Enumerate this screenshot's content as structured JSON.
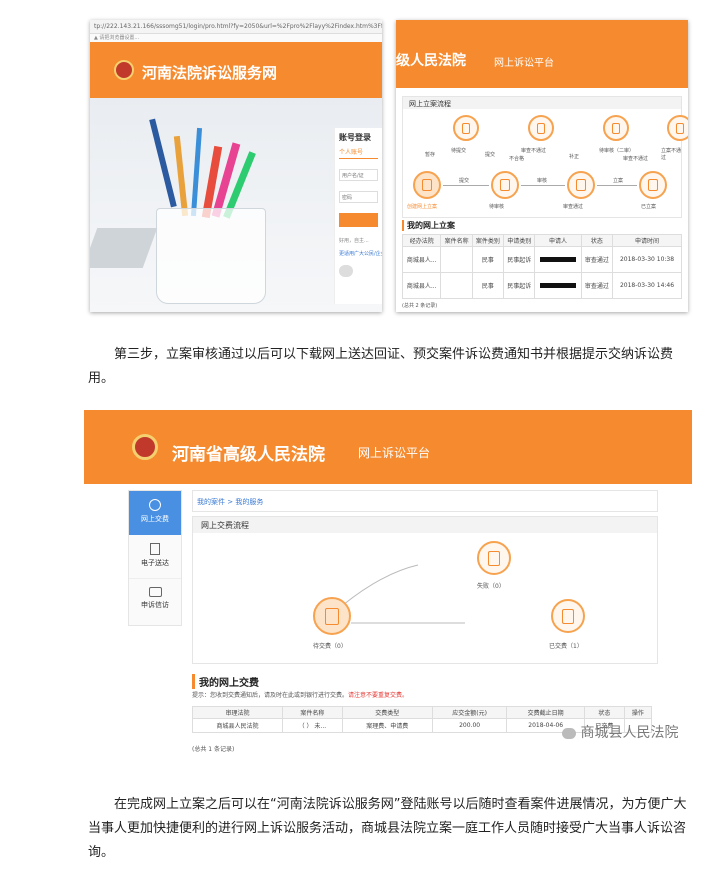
{
  "shot1": {
    "url": "tp://222.143.21.166/sssomg51/login/pro.html?fy=2050&url=%2Fpro%2Flayy%2Findex.htm%3Ffy%3D...",
    "top_note": "▲ 请把浏览器设置...",
    "title": "河南法院诉讼服务网",
    "login_title": "账号登录",
    "login_tab": "个人账号",
    "username_label": "用户名/证",
    "password_label": "密码",
    "foot1": "好用，自主...",
    "foot2": "更适用广大公民/企业"
  },
  "shot2": {
    "title": "级人民法院",
    "subtitle": "网上诉讼平台",
    "flow_title": "网上立案流程",
    "flow_top": [
      "暂存",
      "待提交",
      "提交",
      "待审核",
      "审查不通过",
      "不合格",
      "补正",
      "退回",
      "待审核（二审）",
      "审查不通过",
      "立案不通过"
    ],
    "flow_bottom": [
      "创建网上立案",
      "提交",
      "待审核",
      "审核",
      "审查通过",
      "立案",
      "已立案"
    ],
    "my_cases": "我的网上立案",
    "headers": [
      "经办法院",
      "案件名称",
      "案件类别",
      "申请类别",
      "申请人",
      "状态",
      "申请时间"
    ],
    "rows": [
      [
        "商城县人...",
        "",
        "民事",
        "民事起诉",
        "",
        "审查通过",
        "2018-03-30 10:38"
      ],
      [
        "商城县人...",
        "",
        "民事",
        "民事起诉",
        "",
        "审查通过",
        "2018-03-30 14:46"
      ]
    ],
    "total": "(总共 2 条记录)"
  },
  "para1": "第三步，立案审核通过以后可以下载网上送达回证、预交案件诉讼费通知书并根据提示交纳诉讼费用。",
  "shot3": {
    "title": "河南省高级人民法院",
    "subtitle": "网上诉讼平台",
    "side": [
      "网上交费",
      "电子送达",
      "申诉信访"
    ],
    "breadcrumb": "我的案件 > 我的服务",
    "flow_title": "网上交费流程",
    "fail": "失败（0）",
    "pending": "待交费（0）",
    "paid": "已交费（1）",
    "my_pay": "我的网上交费",
    "hint_prefix": "提示：您收到交费通知后，请及时在此或到银行进行交费。",
    "hint_red": "请注意不要重复交费。",
    "headers": [
      "审理法院",
      "案件名称",
      "交费类型",
      "应交金额(元)",
      "交费截止日期",
      "状态",
      "操作"
    ],
    "row": [
      "商城县人民法院",
      "（   ）    未...",
      "案理费、申请费",
      "200.00",
      "2018-04-06",
      "已交费",
      ""
    ],
    "total": "(总共 1 条记录)",
    "watermark": "商城县人民法院"
  },
  "para2": "在完成网上立案之后可以在“河南法院诉讼服务网”登陆账号以后随时查看案件进展情况，为方便广大当事人更加快捷便利的进行网上诉讼服务活动，商城县法院立案一庭工作人员随时接受广大当事人诉讼咨询。"
}
